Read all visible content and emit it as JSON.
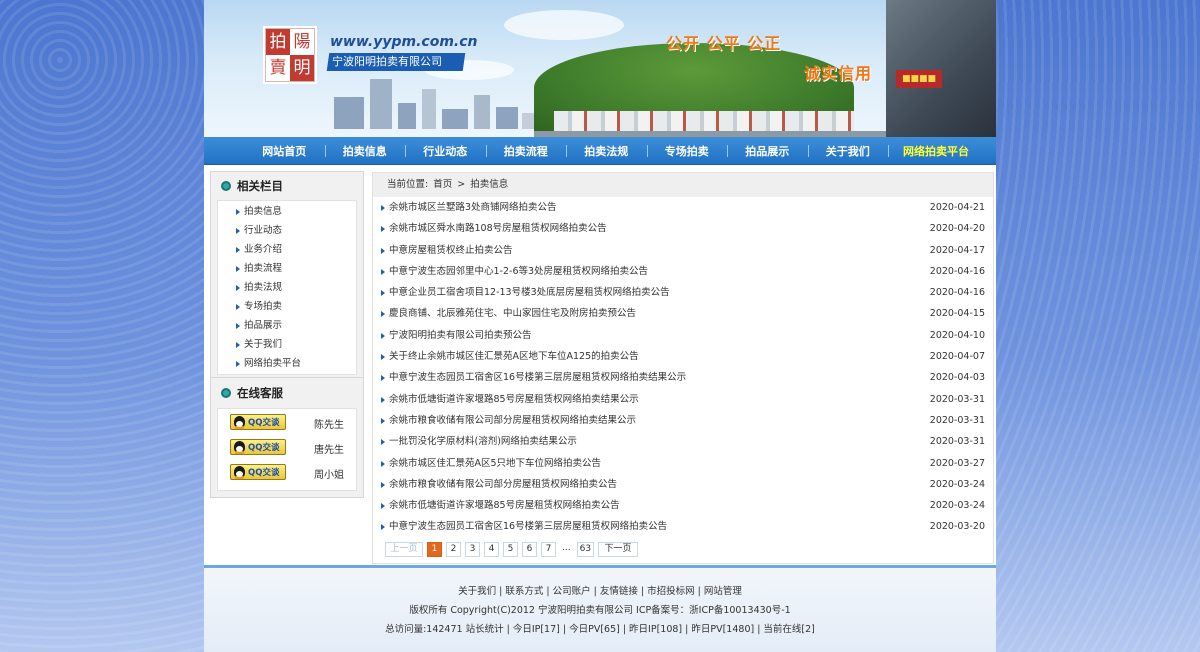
{
  "header": {
    "seal_chars": [
      "拍",
      "陽",
      "賣",
      "明"
    ],
    "url": "www.yypm.com.cn",
    "company": "宁波阳明拍卖有限公司",
    "slogan_1": "公开 公平 公正",
    "slogan_2": "诚实信用"
  },
  "nav": {
    "items": [
      "网站首页",
      "拍卖信息",
      "行业动态",
      "拍卖流程",
      "拍卖法规",
      "专场拍卖",
      "拍品展示",
      "关于我们"
    ],
    "highlight": "网络拍卖平台"
  },
  "sidebar": {
    "related_title": "相关栏目",
    "related_items": [
      "拍卖信息",
      "行业动态",
      "业务介绍",
      "拍卖流程",
      "拍卖法规",
      "专场拍卖",
      "拍品展示",
      "关于我们",
      "网络拍卖平台"
    ],
    "service_title": "在线客服",
    "qq_button_text": "QQ交谈",
    "services": [
      "陈先生",
      "唐先生",
      "周小姐"
    ]
  },
  "breadcrumb": {
    "label": "当前位置:",
    "home": "首页",
    "sep": ">",
    "current": "拍卖信息"
  },
  "news": [
    {
      "title": "余姚市城区兰墅路3处商铺网络拍卖公告",
      "date": "2020-04-21"
    },
    {
      "title": "余姚市城区舜水南路108号房屋租赁权网络拍卖公告",
      "date": "2020-04-20"
    },
    {
      "title": "中意房屋租赁权终止拍卖公告",
      "date": "2020-04-17"
    },
    {
      "title": "中意宁波生态园邻里中心1-2-6等3处房屋租赁权网络拍卖公告",
      "date": "2020-04-16"
    },
    {
      "title": "中意企业员工宿舍项目12-13号楼3处底层房屋租赁权网络拍卖公告",
      "date": "2020-04-16"
    },
    {
      "title": "慶良商铺、北辰雅苑住宅、中山家园住宅及附房拍卖预公告",
      "date": "2020-04-15"
    },
    {
      "title": "宁波阳明拍卖有限公司拍卖预公告",
      "date": "2020-04-10"
    },
    {
      "title": "关于终止余姚市城区佳汇景苑A区地下车位A125的拍卖公告",
      "date": "2020-04-07"
    },
    {
      "title": "中意宁波生态园员工宿舍区16号楼第三层房屋租赁权网络拍卖结果公示",
      "date": "2020-04-03"
    },
    {
      "title": "余姚市低塘街道许家堰路85号房屋租赁权网络拍卖结果公示",
      "date": "2020-03-31"
    },
    {
      "title": "余姚市粮食收储有限公司部分房屋租赁权网络拍卖结果公示",
      "date": "2020-03-31"
    },
    {
      "title": "一批罚没化学原材料(溶剂)网络拍卖结果公示",
      "date": "2020-03-31"
    },
    {
      "title": "余姚市城区佳汇景苑A区5只地下车位网络拍卖公告",
      "date": "2020-03-27"
    },
    {
      "title": "余姚市粮食收储有限公司部分房屋租赁权网络拍卖公告",
      "date": "2020-03-24"
    },
    {
      "title": "余姚市低塘街道许家堰路85号房屋租赁权网络拍卖公告",
      "date": "2020-03-24"
    },
    {
      "title": "中意宁波生态园员工宿舍区16号楼第三层房屋租赁权网络拍卖公告",
      "date": "2020-03-20"
    }
  ],
  "pager": {
    "prev": "上一页",
    "pages": [
      "1",
      "2",
      "3",
      "4",
      "5",
      "6",
      "7"
    ],
    "current": "1",
    "ellipsis": "...",
    "last": "63",
    "next": "下一页"
  },
  "footer": {
    "links": "关于我们 | 联系方式 | 公司账户 | 友情链接 | 市招投标网 | 网站管理",
    "copyright": "版权所有 Copyright(C)2012 宁波阳明拍卖有限公司 ICP备案号：浙ICP备10013430号-1",
    "stats": "总访问量:142471 站长统计 | 今日IP[17] | 今日PV[65] | 昨日IP[108] | 昨日PV[1480] | 当前在线[2]"
  },
  "colors": {
    "nav_blue": "#2271c4",
    "highlight_yellow": "#ffff33",
    "slogan_orange": "#f07816",
    "page_current": "#e4671d"
  }
}
